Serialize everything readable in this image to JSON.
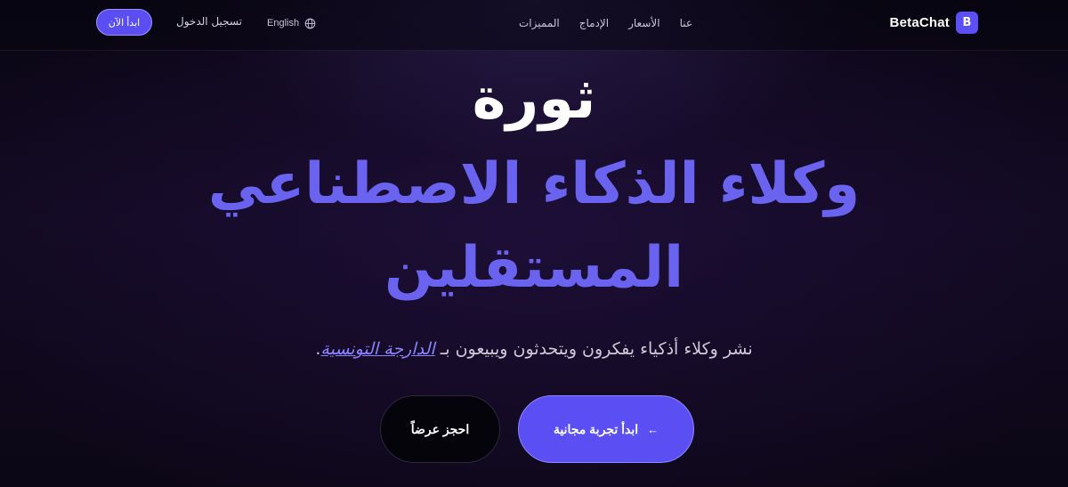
{
  "brand": {
    "logo_letter": "B",
    "name": "BetaChat",
    "accent": "#5b4ff5"
  },
  "nav": {
    "links": [
      "المميزات",
      "الإدماج",
      "الأسعار",
      "عنا"
    ],
    "language_label": "English",
    "login_label": "تسجيل الدخول",
    "cta_label": "ابدأ الآن"
  },
  "hero": {
    "line1": "ثورة",
    "line2": "وكلاء الذكاء الاصطناعي",
    "line3": "المستقلين",
    "subtitle_prefix": "نشر وكلاء أذكياء يفكرون ويتحدثون ويبيعون بـ ",
    "subtitle_link": "الدارجة التونسية",
    "subtitle_suffix": ".",
    "primary_button": "ابدأ تجربة مجانية",
    "primary_icon": "←",
    "secondary_button": "احجز عرضاً",
    "highlight_color": "#6a63f0"
  }
}
